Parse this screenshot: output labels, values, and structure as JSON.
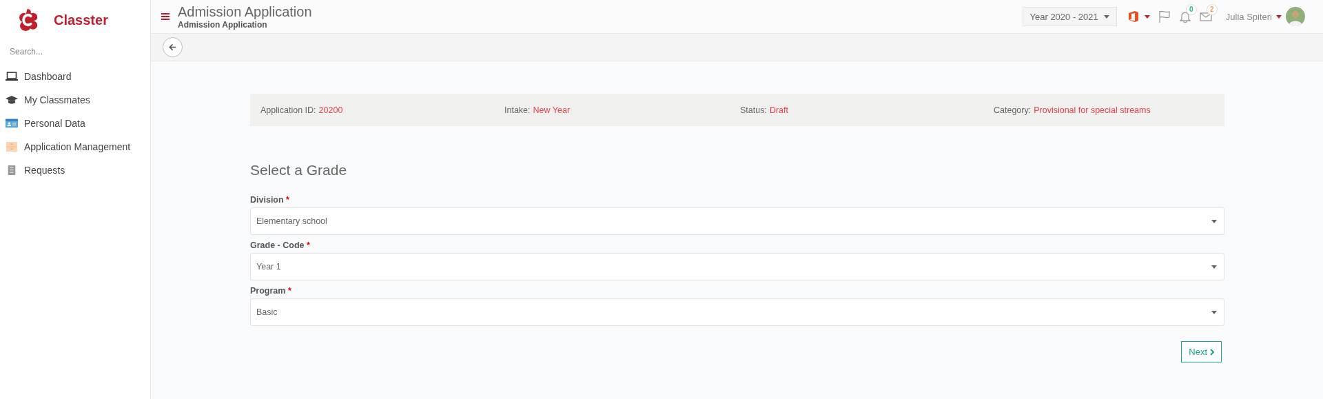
{
  "brand": {
    "name": "Classter"
  },
  "sidebar": {
    "search": {
      "placeholder": "Search..."
    },
    "items": [
      {
        "label": "Dashboard",
        "kind": "laptop"
      },
      {
        "label": "My Classmates",
        "kind": "cap"
      },
      {
        "label": "Personal Data",
        "kind": "card"
      },
      {
        "label": "Application Management",
        "kind": "folder"
      },
      {
        "label": "Requests",
        "kind": "list"
      }
    ]
  },
  "header": {
    "title": "Admission Application",
    "breadcrumb": "Admission Application",
    "year": "Year 2020 - 2021",
    "badges": [
      {
        "kind": "bell",
        "count": "0",
        "color": "#1abc9c"
      },
      {
        "kind": "mail",
        "count": "2",
        "color": "#f39c5a"
      }
    ],
    "user": "Julia Spiteri"
  },
  "info": [
    {
      "label": "Application ID:",
      "value": "20200"
    },
    {
      "label": "Intake:",
      "value": "New Year"
    },
    {
      "label": "Status:",
      "value": "Draft"
    },
    {
      "label": "Category:",
      "value": "Provisional for special streams"
    }
  ],
  "form": {
    "title": "Select a Grade",
    "fields": [
      {
        "label": "Division",
        "marker": "*",
        "value": "Elementary school"
      },
      {
        "label": "Grade - Code",
        "marker": "*",
        "value": "Year 1"
      },
      {
        "label": "Program",
        "marker": "*",
        "value": "Basic"
      }
    ],
    "next": "Next"
  }
}
